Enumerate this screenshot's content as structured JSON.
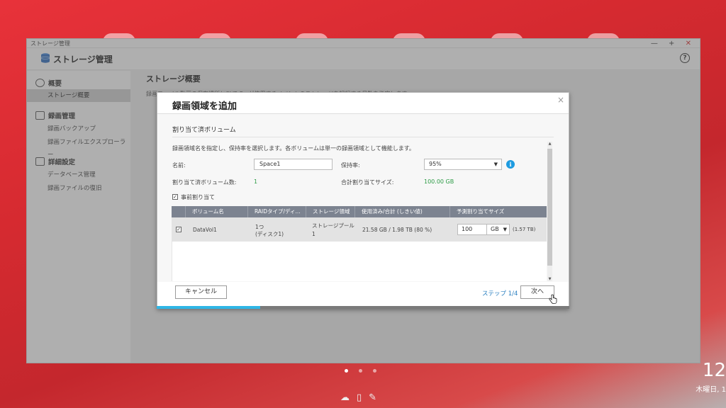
{
  "window": {
    "title": "ストレージ管理",
    "app_title": "ストレージ管理",
    "help": "?",
    "controls": {
      "minimize": "—",
      "maximize": "+",
      "close": "✕"
    }
  },
  "sidebar": {
    "sections": [
      {
        "label": "概要",
        "icon": "gauge-icon",
        "items": [
          {
            "label": "ストレージ概要",
            "active": true
          }
        ]
      },
      {
        "label": "録画管理",
        "icon": "record-icon",
        "items": [
          {
            "label": "録画バックアップ"
          },
          {
            "label": "録画ファイルエクスプローラー"
          }
        ]
      },
      {
        "label": "詳細設定",
        "icon": "settings-icon",
        "items": [
          {
            "label": "データベース管理"
          },
          {
            "label": "録画ファイルの復旧"
          }
        ]
      }
    ]
  },
  "content": {
    "title": "ストレージ概要",
    "desc": "録画ファイル動画の保存場所とQVR Proが使用するイベントのストレージを記録する日数を指定します。"
  },
  "dialog": {
    "title": "録画領域を追加",
    "close": "×",
    "subtitle": "割り当て済ボリューム",
    "instruction": "録画領域名を指定し、保持率を選択します。各ボリュームは単一の録画領域として機能します。",
    "name_label": "名前:",
    "name_value": "Space1",
    "retention_label": "保持率:",
    "retention_value": "95%",
    "allocated_count_label": "割り当て済ボリューム数:",
    "allocated_count_value": "1",
    "total_size_label": "合計割り当てサイズ:",
    "total_size_value": "100.00 GB",
    "preallocate_label": "事前割り当て",
    "preallocate_checked": true,
    "table": {
      "headers": [
        "ボリューム名",
        "RAIDタイプ/ディ...",
        "ストレージ領域",
        "使用済み/合計 (しきい値)",
        "予測割り当てサイズ"
      ],
      "rows": [
        {
          "checked": true,
          "volume": "DataVol1",
          "raid_line1": "1つ",
          "raid_line2": "(ディスク1)",
          "pool_line1": "ストレージプール",
          "pool_line2": "1",
          "usage": "21.58 GB / 1.98 TB (80 %)",
          "alloc_value": "100",
          "alloc_unit": "GB",
          "alloc_max": "(1.57 TB)"
        }
      ]
    },
    "cancel_label": "キャンセル",
    "step_label": "ステップ 1/4",
    "next_label": "次へ",
    "progress": 0.25
  },
  "dock": {
    "icons": [
      "cloud-icon",
      "book-icon",
      "edit-icon"
    ],
    "pages": 3,
    "current_page": 1
  },
  "clock": {
    "time": "12",
    "date": "木曜日, 1"
  },
  "colors": {
    "accent": "#2fb6e6",
    "green": "#2c9b45",
    "table_header": "#7c8390",
    "close_red": "#d32d2d"
  }
}
